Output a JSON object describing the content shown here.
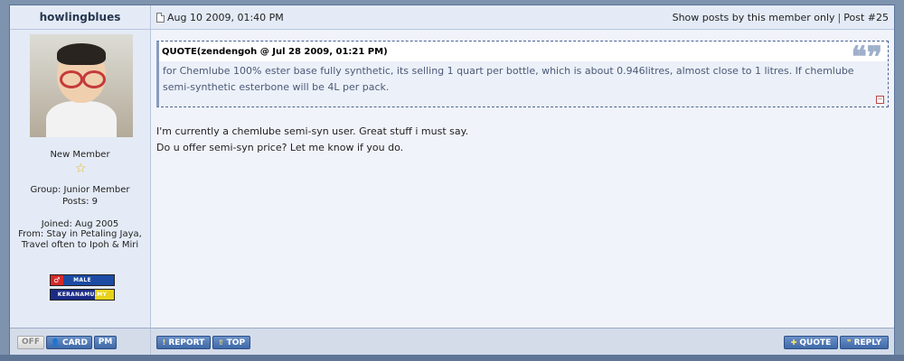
{
  "author": {
    "name": "howlingblues",
    "title": "New Member",
    "group": "Group: Junior Member",
    "posts": "Posts: 9",
    "joined": "Joined: Aug 2005",
    "from_line1": "From: Stay in Petaling Jaya,",
    "from_line2": "Travel often to Ipoh & Miri",
    "badge_male": "MALE",
    "badge_male_symbol": "♂",
    "badge_kera": "KERANAMU.MY"
  },
  "post_header": {
    "date": "Aug 10 2009, 01:40 PM",
    "show_posts_link": "Show posts by this member only",
    "separator": "|",
    "post_number": "Post #25"
  },
  "quote": {
    "title": "QUOTE(zendengoh @ Jul 28 2009, 01:21 PM)",
    "marks": "❝❞",
    "line1": "for Chemlube 100% ester base fully synthetic, its selling 1 quart per bottle, which is about 0.946litres, almost close to 1 litres. If chemlube",
    "line2": "semi-synthetic esterbone will be 4L per pack."
  },
  "post_body": {
    "line1": "I'm currently a chemlube semi-syn user. Great stuff i must say.",
    "line2": "Do u offer semi-syn price? Let me know if you do."
  },
  "buttons": {
    "off": "OFF",
    "card": "CARD",
    "pm": "PM",
    "report": "REPORT",
    "top": "TOP",
    "quote": "QUOTE",
    "reply": "REPLY"
  },
  "colors": {
    "frame": "#7e93ad",
    "post_bg": "#f0f3fa",
    "header_bg": "#e4ebf6",
    "button_blue": "#3f69a8"
  }
}
